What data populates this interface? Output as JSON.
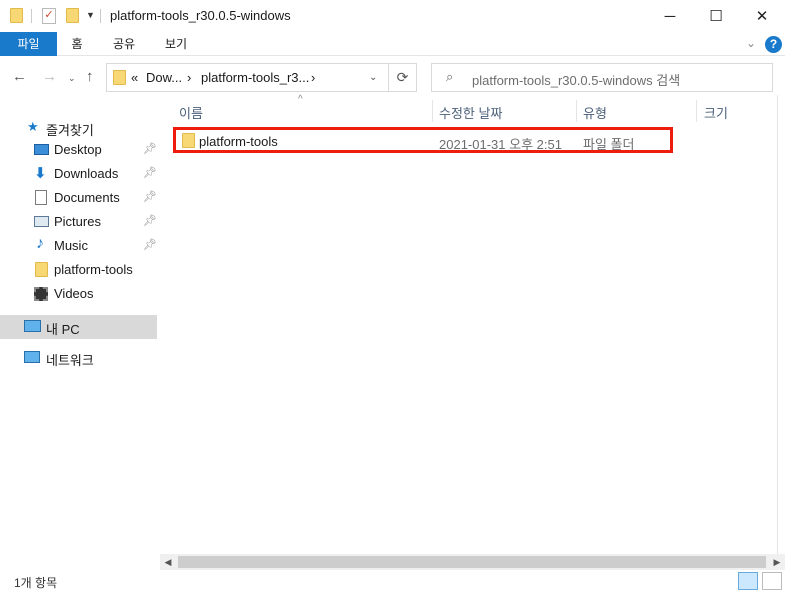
{
  "window": {
    "title": "platform-tools_r30.0.5-windows",
    "controls": {
      "minimize": "─",
      "maximize": "☐",
      "close": "✕"
    }
  },
  "ribbon": {
    "tabs": [
      "파일",
      "홈",
      "공유",
      "보기"
    ],
    "help": "?"
  },
  "address": {
    "prefix": "«",
    "crumbs": [
      "Dow...",
      "platform-tools_r3..."
    ],
    "separator": "›",
    "search_placeholder": "platform-tools_r30.0.5-windows 검색"
  },
  "sidebar": {
    "quick_access": "즐겨찾기",
    "items": [
      {
        "label": "Desktop",
        "icon": "desktop-icon",
        "pinned": true
      },
      {
        "label": "Downloads",
        "icon": "download-icon",
        "pinned": true
      },
      {
        "label": "Documents",
        "icon": "document-icon",
        "pinned": true
      },
      {
        "label": "Pictures",
        "icon": "pictures-icon",
        "pinned": true
      },
      {
        "label": "Music",
        "icon": "music-icon",
        "pinned": true
      },
      {
        "label": "platform-tools",
        "icon": "folder-icon",
        "pinned": false
      },
      {
        "label": "Videos",
        "icon": "video-icon",
        "pinned": false
      }
    ],
    "this_pc": "내 PC",
    "network": "네트워크"
  },
  "columns": [
    "이름",
    "수정한 날짜",
    "유형",
    "크기"
  ],
  "files": [
    {
      "name": "platform-tools",
      "modified": "2021-01-31 오후 2:51",
      "type": "파일 폴더",
      "size": ""
    }
  ],
  "status": {
    "count": "1개 항목"
  },
  "colors": {
    "accent": "#1979ca",
    "highlight": "#ee1c0c",
    "folder": "#f8d775"
  }
}
